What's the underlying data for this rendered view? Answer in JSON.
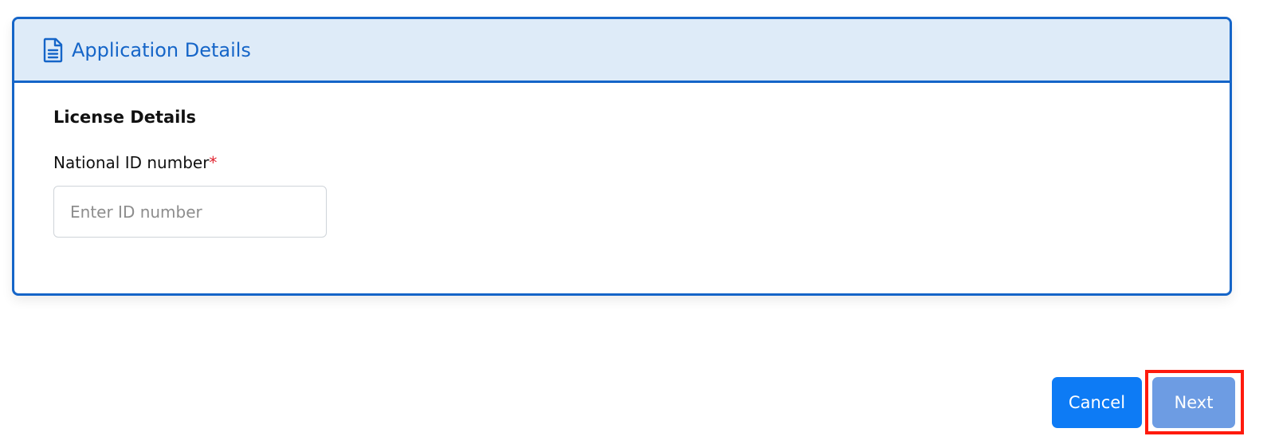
{
  "card": {
    "icon": "document-icon",
    "title": "Application Details",
    "section_title": "License Details",
    "field": {
      "label": "National ID number",
      "required_mark": "*",
      "value": "",
      "placeholder": "Enter ID number"
    }
  },
  "actions": {
    "cancel_label": "Cancel",
    "next_label": "Next",
    "next_highlighted": true
  },
  "colors": {
    "accent": "#1565c8",
    "header_bg": "#deebf8",
    "cancel_bg": "#0d7bf5",
    "next_bg": "#6d9ce3",
    "required": "#e0232f",
    "highlight": "#ff1a0d"
  }
}
